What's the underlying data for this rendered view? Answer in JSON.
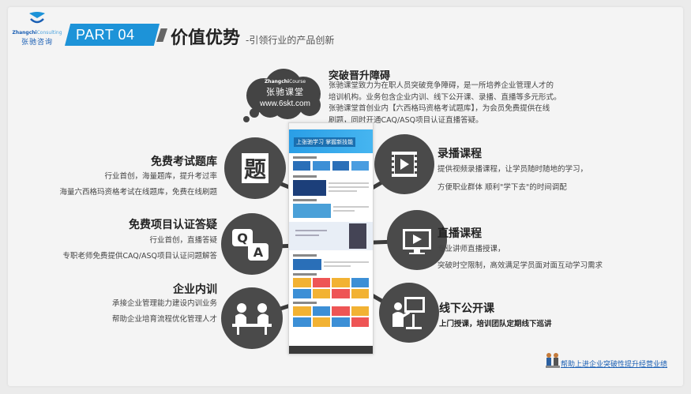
{
  "header": {
    "logo_en_bold": "Zhangchi",
    "logo_en_light": "Consulting",
    "logo_cn": "张驰咨询",
    "part_label": "PART 04",
    "title": "价值优势",
    "subtitle": "-引领行业的产品创新"
  },
  "cloud": {
    "brand_en_bold": "Zhangchi",
    "brand_en_light": "Course",
    "brand_cn": "张驰课堂",
    "url": "www.6skt.com"
  },
  "breakthrough": {
    "title": "突破晋升障碍",
    "lines": [
      "张驰课堂致力为在职人员突破竞争障碍，是一所培养企业管理人才的",
      "培训机构。业务包含企业内训、线下公开课、录播、直播等多元形式。",
      "张驰课堂首创业内【六西格玛资格考试题库】，为会员免费提供在线",
      "刷题，同时开通CAQ/ASQ项目认证直播答疑。"
    ]
  },
  "left_items": [
    {
      "title": "免费考试题库",
      "icon": "exam-bank-icon",
      "lines": [
        "行业首创，海量题库，提升考过率",
        "海量六西格玛资格考试在线题库，免费在线刷题"
      ]
    },
    {
      "title": "免费项目认证答疑",
      "icon": "qa-icon",
      "lines": [
        "行业首创，直播答疑",
        "专职老师免费提供CAQ/ASQ项目认证问题解答"
      ]
    },
    {
      "title": "企业内训",
      "icon": "meeting-icon",
      "lines": [
        "承接企业管理能力建设内训业务",
        "帮助企业培育流程优化管理人才"
      ]
    }
  ],
  "right_items": [
    {
      "title": "录播课程",
      "icon": "film-play-icon",
      "lines": [
        "提供视频录播课程，让学员随时随地的学习，",
        "方便职业群体 顺利\"学下去\"的时间调配"
      ]
    },
    {
      "title": "直播课程",
      "icon": "live-screen-icon",
      "lines": [
        "专业讲师直播授课，",
        "突破时空限制，高效满足学员面对面互动学习需求"
      ]
    },
    {
      "title": "线下公开课",
      "icon": "classroom-icon",
      "lines": [
        "上门授课，培训团队定期线下巡讲"
      ]
    }
  ],
  "screenshot": {
    "banner": "上张驰学习 掌握新技能"
  },
  "footer": {
    "text": "帮助上进企业突破性提升经营业绩"
  },
  "colors": {
    "accent_blue": "#1d93d8",
    "dark_circle": "#4a4a4a",
    "background": "#f4f4f4"
  }
}
